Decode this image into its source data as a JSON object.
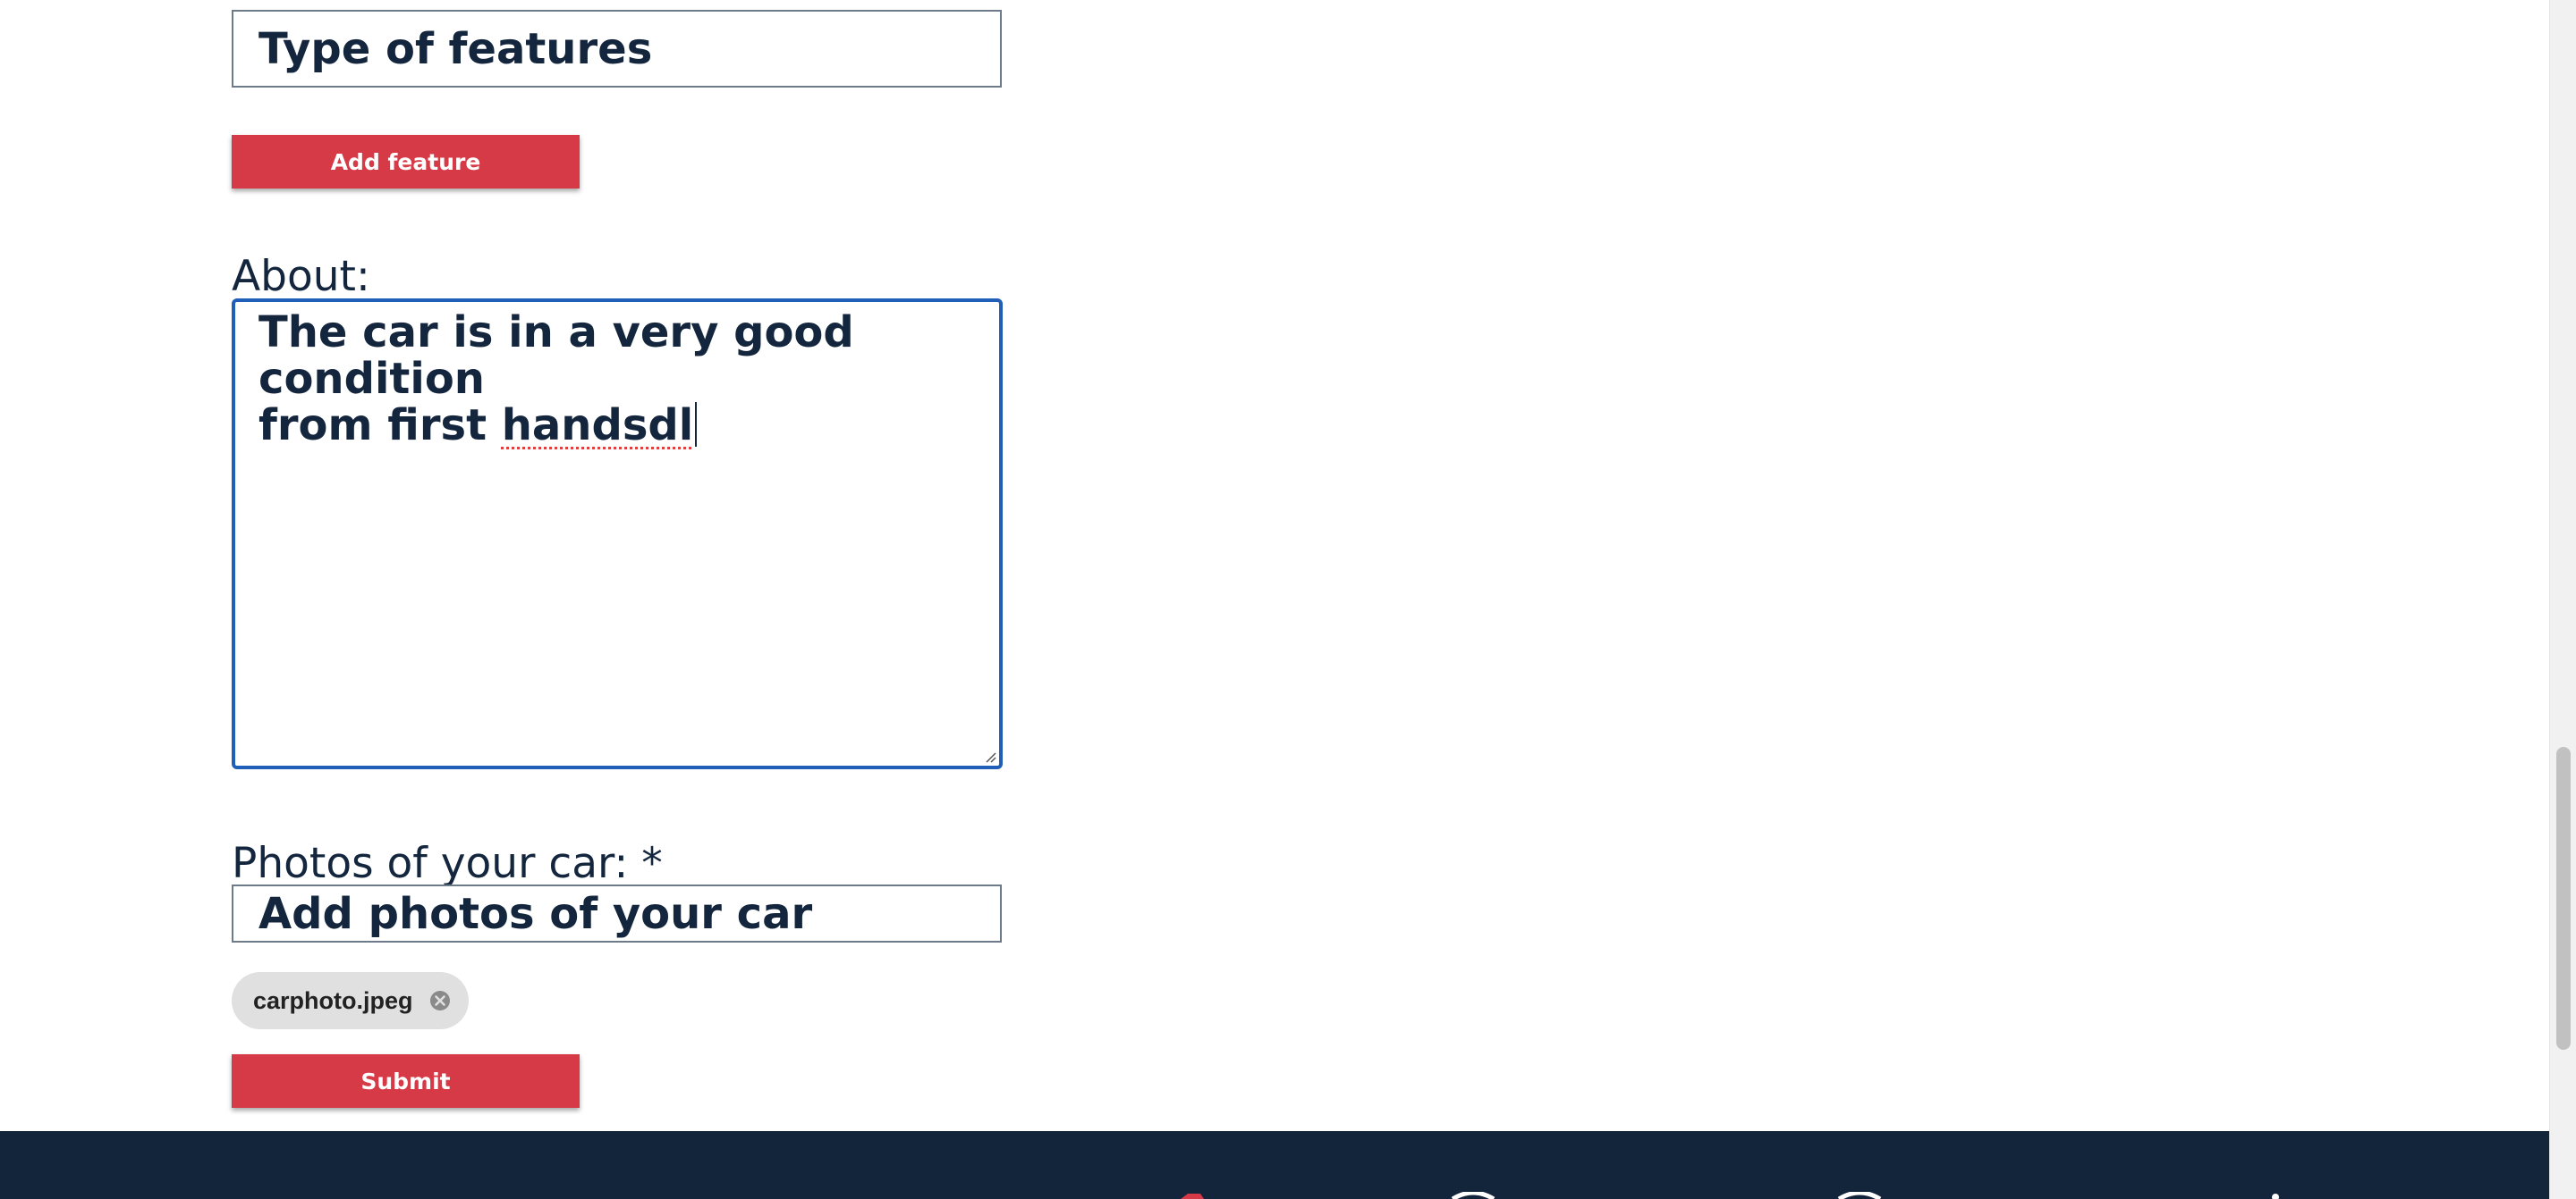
{
  "features": {
    "input_placeholder": "Type of features",
    "add_button_label": "Add feature"
  },
  "about": {
    "label": "About:",
    "value_line1": "The car is in a very good condition",
    "value_line2_prefix": "from first ",
    "value_line2_misspelled": "handsdl"
  },
  "photos": {
    "label": "Photos of your car: *",
    "input_placeholder": "Add photos of your car",
    "files": [
      {
        "name": "carphoto.jpeg"
      }
    ]
  },
  "form": {
    "submit_label": "Submit"
  },
  "colors": {
    "accent_red": "#d63a47",
    "text_navy": "#14263d",
    "focus_blue": "#1f5fb8",
    "footer_bg": "#13253a"
  },
  "icons": {
    "chip_remove": "close-circle-icon",
    "textarea_resize": "resize-handle-icon"
  }
}
